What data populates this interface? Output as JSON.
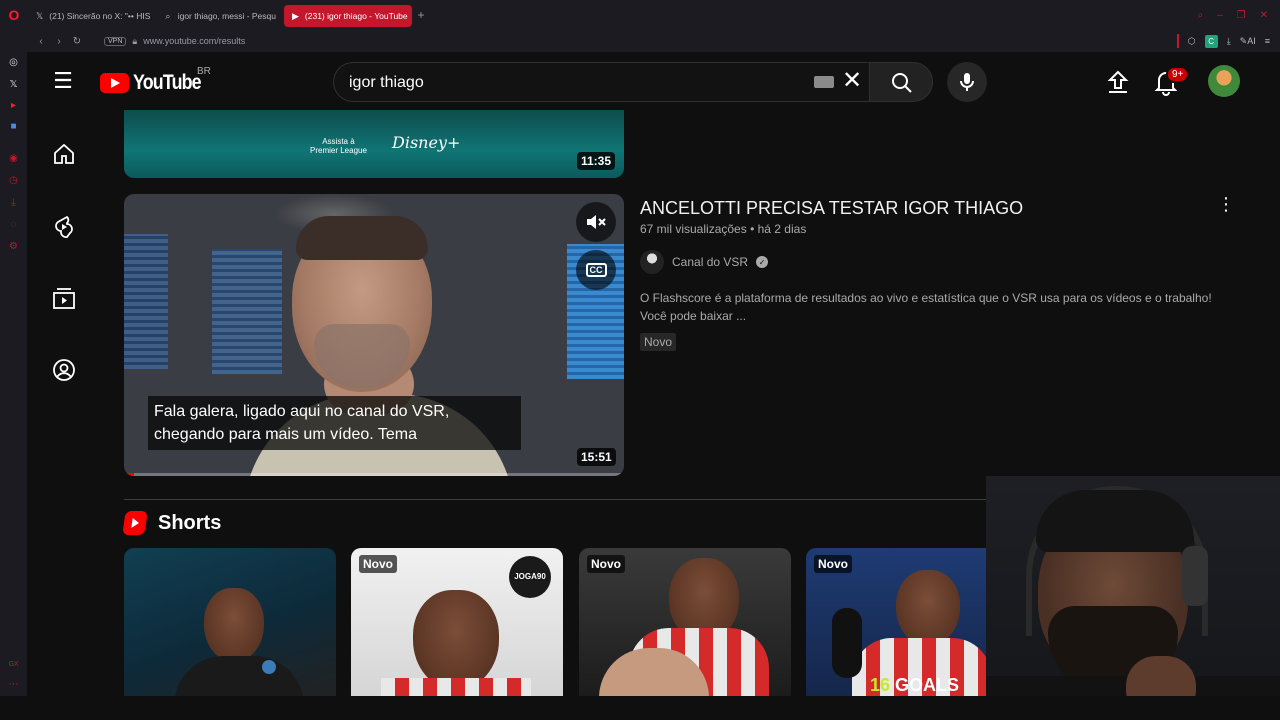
{
  "browser": {
    "tabs": [
      {
        "label": "(21) Sincerão no X: \"•• HIS",
        "icon": "x-icon",
        "active": false
      },
      {
        "label": "igor thiago, messi - Pesqu",
        "icon": "search-icon",
        "active": false
      },
      {
        "label": "(231) igor thiago - YouTube",
        "icon": "youtube-icon",
        "active": true
      }
    ],
    "vpn_label": "VPN",
    "url": "www.youtube.com/results",
    "ext_c": "C",
    "ai_label": "AI"
  },
  "youtube": {
    "logo_text": "YouTube",
    "country_code": "BR",
    "search_value": "igor thiago",
    "notification_count": "9+"
  },
  "results": {
    "top_video": {
      "duration": "11:35",
      "promo_line1": "Assista à",
      "promo_line2": "Premier League",
      "promo_brand": "Disney+"
    },
    "main_video": {
      "title": "ANCELOTTI PRECISA TESTAR IGOR THIAGO",
      "views": "67 mil visualizações",
      "age": "há 2 dias",
      "channel": "Canal do VSR",
      "description": "O Flashscore é a plataforma de resultados ao vivo e estatística que o VSR usa para os vídeos e o trabalho! Você pode baixar ...",
      "badge": "Novo",
      "duration": "15:51",
      "caption": "Fala galera, ligado aqui no canal do VSR, chegando para mais um vídeo. Tema",
      "cc_label": "CC",
      "progress": 0.02
    }
  },
  "shorts": {
    "title": "Shorts",
    "items": [
      {
        "badge": ""
      },
      {
        "badge": "Novo",
        "watermark": "JOGA90"
      },
      {
        "badge": "Novo"
      },
      {
        "badge": "Novo",
        "overlay_number": "16",
        "overlay_text": "GOALS"
      }
    ]
  },
  "colors": {
    "accent": "#ff0000",
    "opera_red": "#c4172c",
    "background": "#0f0f0f"
  }
}
